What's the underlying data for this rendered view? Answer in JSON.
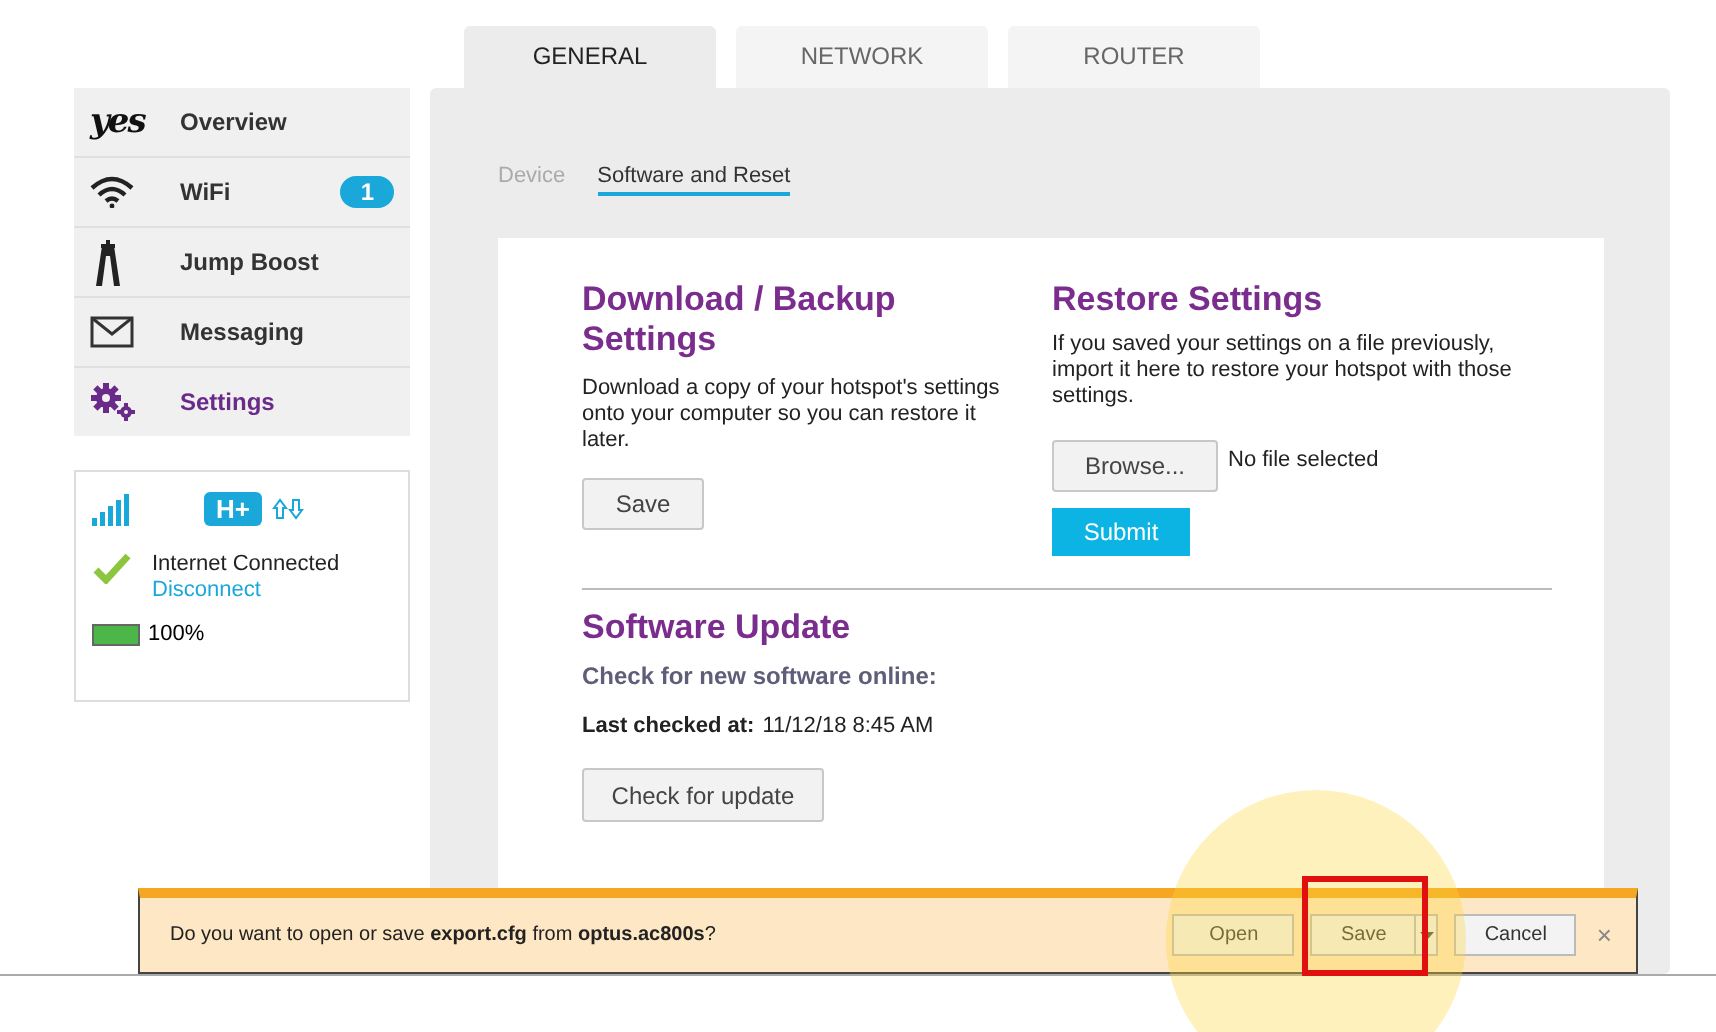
{
  "tabs": [
    {
      "label": "GENERAL",
      "selected": true
    },
    {
      "label": "NETWORK",
      "selected": false
    },
    {
      "label": "ROUTER",
      "selected": false
    }
  ],
  "sidebar": {
    "items": [
      {
        "kind": "logo",
        "logo_text": "yes",
        "label": "Overview",
        "selected": false
      },
      {
        "kind": "wifi",
        "label": "WiFi",
        "badge": "1",
        "selected": false
      },
      {
        "kind": "boost",
        "label": "Jump Boost",
        "selected": false
      },
      {
        "kind": "mail",
        "label": "Messaging",
        "selected": false
      },
      {
        "kind": "gear",
        "label": "Settings",
        "selected": true
      }
    ]
  },
  "status": {
    "network_type": "H+",
    "connection": "Internet Connected",
    "action": "Disconnect",
    "battery": {
      "level": 1,
      "reading": "100%"
    }
  },
  "subtabs": [
    {
      "label": "Device",
      "selected": false
    },
    {
      "label": "Software and Reset",
      "selected": true
    }
  ],
  "backup": {
    "title": "Download / Backup Settings",
    "text": "Download a copy of your hotspot's settings onto your computer so you can restore it later.",
    "button": "Save"
  },
  "restore": {
    "title": "Restore Settings",
    "text": "If you saved your settings on a file previously, import it here to restore your hotspot with those settings.",
    "browse": "Browse...",
    "file_status": "No file selected",
    "submit": "Submit"
  },
  "update": {
    "title": "Software Update",
    "subtitle": "Check for new software online:",
    "last_checked_label": "Last checked at:",
    "last_checked": "11/12/18 8:45 AM",
    "button": "Check for update"
  },
  "download_bar": {
    "message": "Do you want to open or save **export.cfg** from **optus.ac800s**?",
    "buttons": [
      {
        "label": "Open",
        "kind": "plain"
      },
      {
        "label": "Save",
        "kind": "split"
      },
      {
        "label": "Cancel",
        "kind": "plain"
      }
    ],
    "close": "×"
  }
}
